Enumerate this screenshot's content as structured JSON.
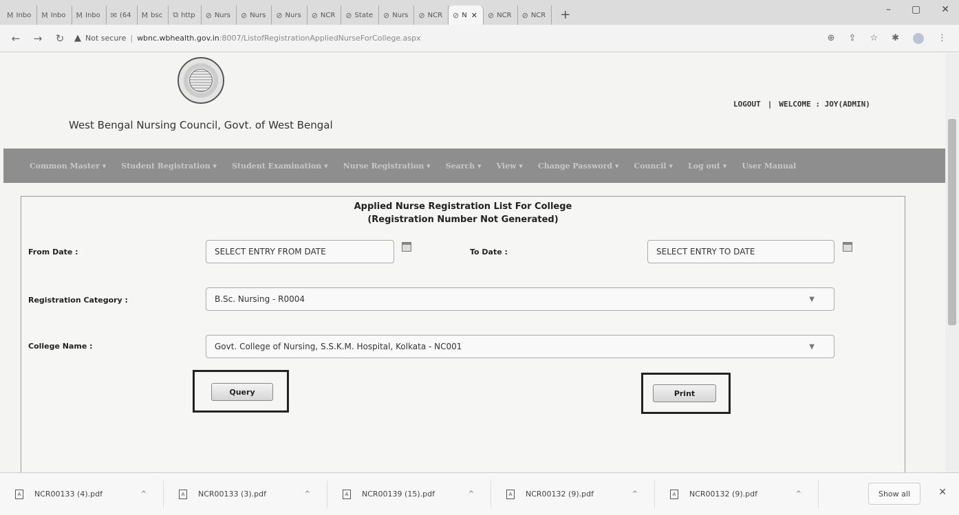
{
  "browser": {
    "tabs": [
      {
        "favicon": "M",
        "label": "Inbo"
      },
      {
        "favicon": "M",
        "label": "Inbo"
      },
      {
        "favicon": "M",
        "label": "Inbo"
      },
      {
        "favicon": "✉",
        "label": "(64"
      },
      {
        "favicon": "M",
        "label": "bsc"
      },
      {
        "favicon": "⧉",
        "label": "http"
      },
      {
        "favicon": "⊘",
        "label": "Nurs"
      },
      {
        "favicon": "⊘",
        "label": "Nurs"
      },
      {
        "favicon": "⊘",
        "label": "Nurs"
      },
      {
        "favicon": "⊘",
        "label": "NCR"
      },
      {
        "favicon": "⊘",
        "label": "State"
      },
      {
        "favicon": "⊘",
        "label": "Nurs"
      },
      {
        "favicon": "⊘",
        "label": "NCR"
      },
      {
        "favicon": "⊘",
        "label": "N",
        "active": true
      },
      {
        "favicon": "⊘",
        "label": "NCR"
      },
      {
        "favicon": "⊘",
        "label": "NCR"
      }
    ],
    "tab_close": "✕",
    "new_tab": "+",
    "window_controls": {
      "minimize": "–",
      "restore": "▢",
      "close": "✕"
    },
    "address": {
      "security": "Not secure",
      "host": "wbnc.wbhealth.gov.in",
      "path": ":8007/ListofRegistrationAppliedNurseForCollege.aspx"
    }
  },
  "site": {
    "title": "West Bengal Nursing Council, Govt. of West Bengal",
    "logout": "LOGOUT",
    "separator": "|",
    "welcome": "WELCOME : JOY(ADMIN)"
  },
  "menu": [
    "Common Master ▾",
    "Student Registration ▾",
    "Student Examination ▾",
    "Nurse Registration ▾",
    "Search ▾",
    "View ▾",
    "Change Password ▾",
    "Council ▾",
    "Log out ▾",
    "User Manual"
  ],
  "form": {
    "title_line1": "Applied Nurse Registration List For College",
    "title_line2": "(Registration Number Not Generated)",
    "from_date_label": "From Date :",
    "from_date_value": "SELECT ENTRY FROM DATE",
    "to_date_label": "To Date :",
    "to_date_value": "SELECT ENTRY TO DATE",
    "reg_category_label": "Registration Category :",
    "reg_category_value": "B.Sc. Nursing - R0004",
    "college_label": "College Name :",
    "college_value": "Govt. College of Nursing, S.S.K.M. Hospital, Kolkata - NC001",
    "query_button": "Query",
    "print_button": "Print"
  },
  "downloads": {
    "items": [
      "NCR00133 (4).pdf",
      "NCR00133 (3).pdf",
      "NCR00139 (15).pdf",
      "NCR00132 (9).pdf",
      "NCR00132 (9).pdf"
    ],
    "show_all": "Show all",
    "close": "✕"
  }
}
